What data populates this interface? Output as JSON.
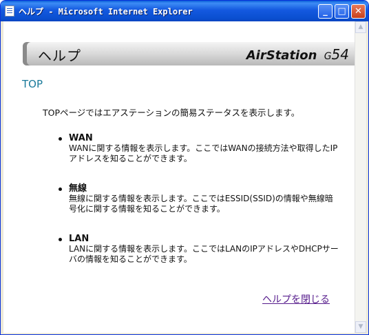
{
  "window": {
    "title": "ヘルプ - Microsoft Internet Explorer",
    "minimize_icon": "minimize-icon",
    "maximize_icon": "maximize-icon",
    "close_icon": "close-icon"
  },
  "banner": {
    "title": "ヘルプ",
    "logo_brand": "AirStation",
    "logo_g": "G",
    "logo_model": "54"
  },
  "section": {
    "title": "TOP",
    "intro": "TOPページではエアステーションの簡易ステータスを表示します。"
  },
  "items": [
    {
      "title": "WAN",
      "desc": "WANに関する情報を表示します。ここではWANの接続方法や取得したIPアドレスを知ることができます。"
    },
    {
      "title": "無線",
      "desc": "無線に関する情報を表示します。ここではESSID(SSID)の情報や無線暗号化に関する情報を知ることができます。"
    },
    {
      "title": "LAN",
      "desc": "LANに関する情報を表示します。ここではLANのIPアドレスやDHCPサーバの情報を知ることができます。"
    }
  ],
  "close_link": "ヘルプを閉じる"
}
